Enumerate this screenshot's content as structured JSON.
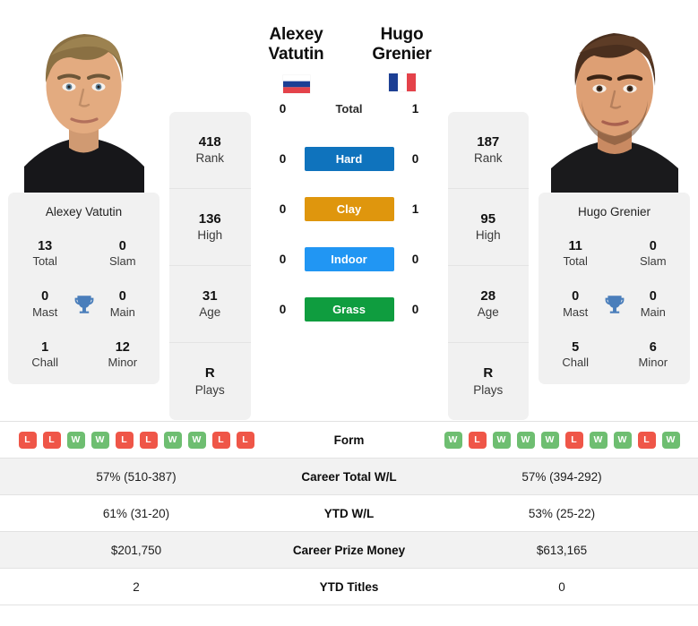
{
  "players": {
    "left": {
      "name_line1": "Alexey",
      "name_line2": "Vatutin",
      "full_name": "Alexey Vatutin",
      "country": "Russia",
      "flag_icon": "flag-russia",
      "rank": "418",
      "rank_label": "Rank",
      "high": "136",
      "high_label": "High",
      "age": "31",
      "age_label": "Age",
      "plays": "R",
      "plays_label": "Plays",
      "titles": {
        "total": "13",
        "total_label": "Total",
        "slam": "0",
        "slam_label": "Slam",
        "mast": "0",
        "mast_label": "Mast",
        "main": "0",
        "main_label": "Main",
        "chall": "1",
        "chall_label": "Chall",
        "minor": "12",
        "minor_label": "Minor"
      },
      "form": [
        "L",
        "L",
        "W",
        "W",
        "L",
        "L",
        "W",
        "W",
        "L",
        "L"
      ],
      "career_wl": "57% (510-387)",
      "ytd_wl": "61% (31-20)",
      "career_prize": "$201,750",
      "ytd_titles": "2"
    },
    "right": {
      "name_line1": "Hugo Grenier",
      "name_line2": "",
      "full_name": "Hugo Grenier",
      "country": "France",
      "flag_icon": "flag-france",
      "rank": "187",
      "rank_label": "Rank",
      "high": "95",
      "high_label": "High",
      "age": "28",
      "age_label": "Age",
      "plays": "R",
      "plays_label": "Plays",
      "titles": {
        "total": "11",
        "total_label": "Total",
        "slam": "0",
        "slam_label": "Slam",
        "mast": "0",
        "mast_label": "Mast",
        "main": "0",
        "main_label": "Main",
        "chall": "5",
        "chall_label": "Chall",
        "minor": "6",
        "minor_label": "Minor"
      },
      "form": [
        "W",
        "L",
        "W",
        "W",
        "W",
        "L",
        "W",
        "W",
        "L",
        "W"
      ],
      "career_wl": "57% (394-292)",
      "ytd_wl": "53% (25-22)",
      "career_prize": "$613,165",
      "ytd_titles": "0"
    }
  },
  "head_to_head": [
    {
      "label": "Total",
      "left": "0",
      "right": "1",
      "color": "",
      "style": "plain"
    },
    {
      "label": "Hard",
      "left": "0",
      "right": "0",
      "color": "#0f73bd",
      "style": "badge"
    },
    {
      "label": "Clay",
      "left": "0",
      "right": "1",
      "color": "#df960d",
      "style": "badge"
    },
    {
      "label": "Indoor",
      "left": "0",
      "right": "0",
      "color": "#2196f3",
      "style": "badge"
    },
    {
      "label": "Grass",
      "left": "0",
      "right": "0",
      "color": "#0f9d3f",
      "style": "badge"
    }
  ],
  "table_rows": [
    {
      "label": "Form",
      "type": "form",
      "left": "",
      "right": ""
    },
    {
      "label": "Career Total W/L",
      "type": "text",
      "left": "57% (510-387)",
      "right": "57% (394-292)"
    },
    {
      "label": "YTD W/L",
      "type": "text",
      "left": "61% (31-20)",
      "right": "53% (25-22)"
    },
    {
      "label": "Career Prize Money",
      "type": "text",
      "left": "$201,750",
      "right": "$613,165"
    },
    {
      "label": "YTD Titles",
      "type": "text",
      "left": "2",
      "right": "0"
    }
  ],
  "icons": {
    "trophy": "trophy-icon"
  },
  "colors": {
    "win": "#6ebe71",
    "loss": "#ef5648",
    "card_bg": "#f1f1f1",
    "row_shade": "#f2f2f2",
    "trophy": "#4a7ebb"
  }
}
